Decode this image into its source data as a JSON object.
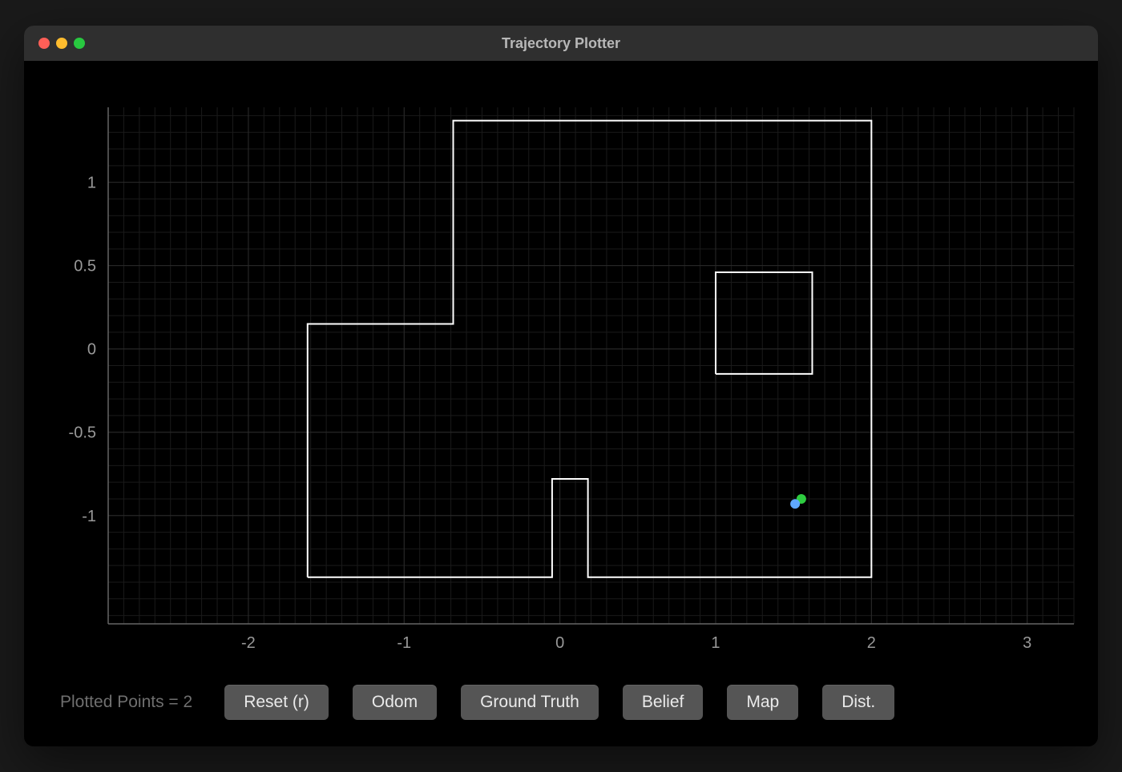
{
  "window": {
    "title": "Trajectory Plotter"
  },
  "status": {
    "label_prefix": "Plotted Points = ",
    "count": "2"
  },
  "buttons": {
    "reset": "Reset (r)",
    "odom": "Odom",
    "ground_truth": "Ground Truth",
    "belief": "Belief",
    "map": "Map",
    "dist": "Dist."
  },
  "chart_data": {
    "type": "scatter",
    "title": "",
    "xlabel": "",
    "ylabel": "",
    "xlim": [
      -2.9,
      3.3
    ],
    "ylim": [
      -1.65,
      1.45
    ],
    "x_ticks": [
      "-2",
      "-1",
      "0",
      "1",
      "2",
      "3"
    ],
    "y_ticks": [
      "-1",
      "-0.5",
      "0",
      "0.5",
      "1"
    ],
    "map_outline": [
      [
        -1.62,
        -1.37
      ],
      [
        -1.62,
        0.15
      ],
      [
        -0.685,
        0.15
      ],
      [
        -0.685,
        1.37
      ],
      [
        2.0,
        1.37
      ],
      [
        2.0,
        -1.37
      ],
      [
        0.18,
        -1.37
      ],
      [
        0.18,
        -0.78
      ],
      [
        -0.05,
        -0.78
      ],
      [
        -0.05,
        -1.37
      ],
      [
        -1.62,
        -1.37
      ]
    ],
    "map_obstacle": [
      [
        1.0,
        -0.15
      ],
      [
        1.62,
        -0.15
      ],
      [
        1.62,
        0.46
      ],
      [
        1.0,
        0.46
      ],
      [
        1.0,
        -0.15
      ]
    ],
    "series": [
      {
        "name": "ground_truth",
        "color": "#2ecc40",
        "points": [
          [
            1.55,
            -0.9
          ]
        ]
      },
      {
        "name": "odom",
        "color": "#5fa8ff",
        "points": [
          [
            1.51,
            -0.93
          ]
        ]
      }
    ]
  }
}
